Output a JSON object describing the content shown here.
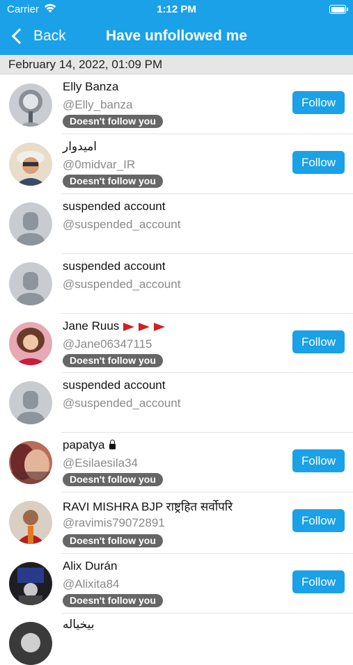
{
  "status": {
    "carrier": "Carrier",
    "time": "1:12 PM"
  },
  "nav": {
    "back_label": "Back",
    "title": "Have unfollowed me"
  },
  "date_header": "February 14, 2022, 01:09 PM",
  "follow_label": "Follow",
  "badge_label": "Doesn't follow you",
  "users": [
    {
      "name": "Elly Banza",
      "handle": "@Elly_banza",
      "avatar": "photo-globe"
    },
    {
      "name": "امیدوار",
      "handle": "@0midvar_IR",
      "avatar": "photo-man-cap"
    },
    {
      "name": "suspended account",
      "handle": "@suspended_account",
      "avatar": "placeholder-silhouette"
    },
    {
      "name": "suspended account",
      "handle": "@suspended_account",
      "avatar": "placeholder-silhouette"
    },
    {
      "name": "Jane Ruus",
      "handle": "@Jane06347115",
      "avatar": "photo-woman-red",
      "name_icons": [
        "red-flag-icon",
        "red-flag-icon",
        "red-flag-icon"
      ]
    },
    {
      "name": "suspended account",
      "handle": "@suspended_account",
      "avatar": "placeholder-silhouette"
    },
    {
      "name": "papatya",
      "handle": "@Esilaesila34",
      "avatar": "photo-face-closeup",
      "name_icons": [
        "lock-icon"
      ]
    },
    {
      "name": "RAVI MISHRA BJP राष्ट्रहित सर्वोपरि",
      "handle": "@ravimis79072891",
      "avatar": "photo-man-red"
    },
    {
      "name": "Alix Durán",
      "handle": "@Alixita84",
      "avatar": "photo-dark-tablet"
    },
    {
      "name": "بیخیاله",
      "handle": "",
      "avatar": "photo-partial"
    }
  ]
}
